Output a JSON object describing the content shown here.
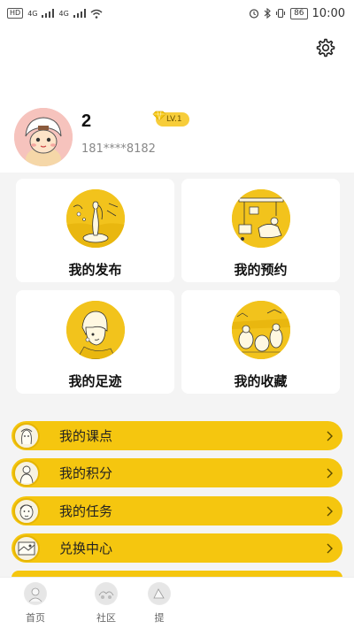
{
  "status_bar": {
    "left_chip": "HD",
    "signal_1": "4G",
    "signal_2": "4G",
    "battery": "86",
    "time": "10:00"
  },
  "profile": {
    "username": "2",
    "phone": "181****8182",
    "level": "LV.1",
    "settings_icon": "gear-icon"
  },
  "cards": [
    {
      "label": "我的发布",
      "icon": "venus-illustration"
    },
    {
      "label": "我的预约",
      "icon": "workshop-illustration"
    },
    {
      "label": "我的足迹",
      "icon": "pearl-earring-illustration"
    },
    {
      "label": "我的收藏",
      "icon": "gleaners-illustration"
    }
  ],
  "list": [
    {
      "label": "我的课点",
      "icon": "portrait-icon"
    },
    {
      "label": "我的积分",
      "icon": "figure-icon"
    },
    {
      "label": "我的任务",
      "icon": "face-icon"
    },
    {
      "label": "兑换中心",
      "icon": "scene-icon"
    }
  ],
  "bottom_nav": [
    {
      "label": "首页",
      "icon": "home-art-icon"
    },
    {
      "label": "社区",
      "icon": "community-art-icon"
    },
    {
      "label": "提",
      "icon": "third-art-icon"
    }
  ],
  "colors": {
    "accent": "#f5c60f",
    "card_circle": "#f2c31c",
    "background": "#f4f4f4"
  }
}
